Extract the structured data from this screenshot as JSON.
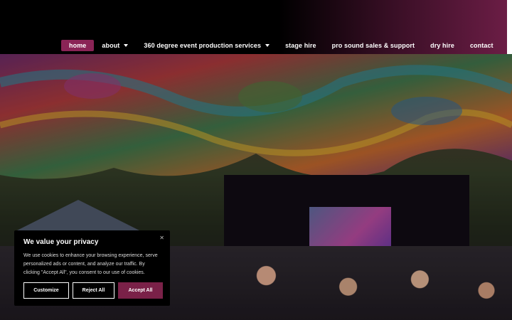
{
  "nav": {
    "items": [
      {
        "label": "home",
        "active": true,
        "has_dropdown": false
      },
      {
        "label": "about",
        "active": false,
        "has_dropdown": true
      },
      {
        "label": "360 degree event production services",
        "active": false,
        "has_dropdown": true
      },
      {
        "label": "stage hire",
        "active": false,
        "has_dropdown": false
      },
      {
        "label": "pro sound sales & support",
        "active": false,
        "has_dropdown": false
      },
      {
        "label": "dry hire",
        "active": false,
        "has_dropdown": false
      },
      {
        "label": "contact",
        "active": false,
        "has_dropdown": false
      }
    ]
  },
  "cookie_banner": {
    "title": "We value your privacy",
    "text": "We use cookies to enhance your browsing experience, serve personalized ads or content, and analyze our traffic. By clicking \"Accept All\", you consent to our use of cookies.",
    "close_icon": "close-icon",
    "buttons": {
      "customize": "Customize",
      "reject": "Reject All",
      "accept": "Accept All"
    }
  },
  "colors": {
    "accent": "#8a2456",
    "accept_button": "#7a2148",
    "header_gradient_end": "#6b1d45"
  }
}
